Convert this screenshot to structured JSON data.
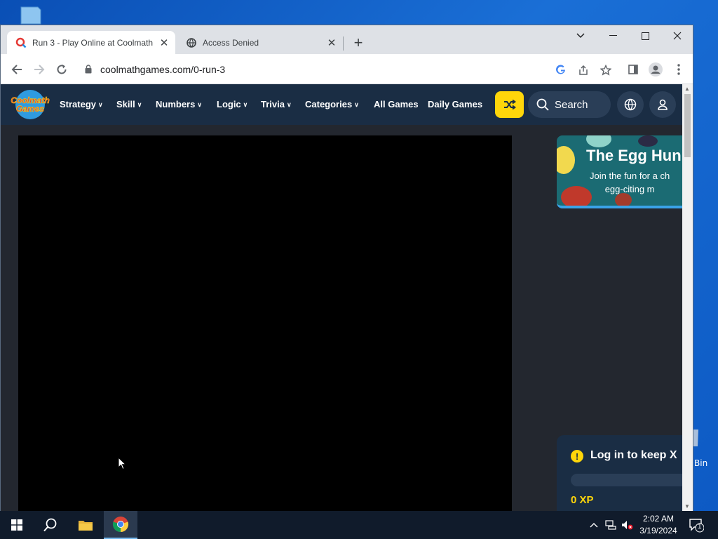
{
  "browser": {
    "tabs": [
      {
        "title": "Run 3 - Play Online at Coolmath",
        "active": true
      },
      {
        "title": "Access Denied",
        "active": false
      }
    ],
    "url": "coolmathgames.com/0-run-3"
  },
  "site": {
    "logo_text": "Coolmath Games",
    "nav": [
      {
        "label": "Strategy",
        "has_dropdown": true
      },
      {
        "label": "Skill",
        "has_dropdown": true
      },
      {
        "label": "Numbers",
        "has_dropdown": true
      },
      {
        "label": "Logic",
        "has_dropdown": true
      },
      {
        "label": "Trivia",
        "has_dropdown": true
      },
      {
        "label": "Categories",
        "has_dropdown": true
      },
      {
        "label": "All Games",
        "has_dropdown": false
      },
      {
        "label": "Daily Games",
        "has_dropdown": false
      }
    ],
    "search_label": "Search",
    "promo": {
      "title": "The Egg Hun",
      "subtitle_line1": "Join the fun for a ch",
      "subtitle_line2": "egg-citing m"
    },
    "login_card": {
      "text": "Log in to keep",
      "close_glyph": "X",
      "xp_label": "0 XP"
    }
  },
  "desktop": {
    "recycle_label": "Bin"
  },
  "taskbar": {
    "time": "2:02 AM",
    "date": "3/19/2024",
    "notification_count": "1"
  },
  "colors": {
    "site_nav_bg": "#1a2d44",
    "accent_yellow": "#ffd60a",
    "page_bg": "#23272f"
  }
}
